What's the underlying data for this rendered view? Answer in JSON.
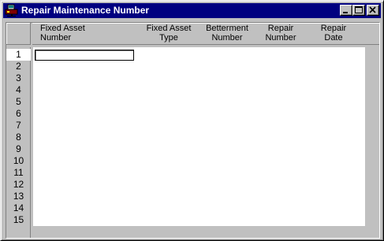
{
  "window": {
    "title": "Repair Maintenance Number",
    "icon": "app-icon",
    "controls": [
      "minimize-icon",
      "maximize-icon",
      "close-icon"
    ]
  },
  "columns": [
    {
      "line1": "Fixed Asset",
      "line2": "Number"
    },
    {
      "line1": "Fixed  Asset",
      "line2": "Type"
    },
    {
      "line1": "Betterment",
      "line2": "Number"
    },
    {
      "line1": "Repair",
      "line2": "Number"
    },
    {
      "line1": "Repair",
      "line2": "Date"
    }
  ],
  "rows": [
    "1",
    "2",
    "3",
    "4",
    "5",
    "6",
    "7",
    "8",
    "9",
    "10",
    "11",
    "12",
    "13",
    "14",
    "15"
  ],
  "active_row": "1",
  "input": {
    "value": ""
  },
  "colors": {
    "titlebar": "#000080",
    "face": "#c0c0c0",
    "grid_bg": "#ffffff"
  }
}
